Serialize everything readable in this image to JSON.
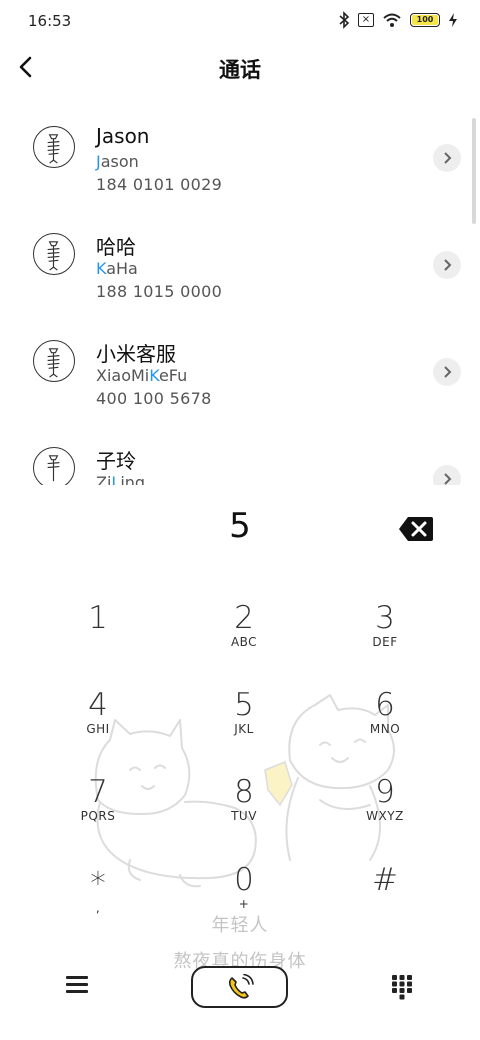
{
  "status_bar": {
    "time": "16:53",
    "battery": "100"
  },
  "header": {
    "title": "通话"
  },
  "contacts": [
    {
      "name": "Jason",
      "pinyin_hl": "J",
      "pinyin_rest": "ason",
      "phone": "184 0101 0029"
    },
    {
      "name": "哈哈",
      "pinyin_hl": "K",
      "pinyin_rest": "aHa",
      "phone": "188 1015 0000"
    },
    {
      "name": "小米客服",
      "pinyin_pre": "XiaoMi",
      "pinyin_hl": "K",
      "pinyin_rest": "eFu",
      "phone": "400 100 5678"
    },
    {
      "name": "子玲",
      "pinyin_pre": "Zi",
      "pinyin_hl": "L",
      "pinyin_rest": "ing",
      "phone": ""
    }
  ],
  "dialer": {
    "input": "5",
    "keys": [
      {
        "digit": "1",
        "letters": ""
      },
      {
        "digit": "2",
        "letters": "ABC"
      },
      {
        "digit": "3",
        "letters": "DEF"
      },
      {
        "digit": "4",
        "letters": "GHI"
      },
      {
        "digit": "5",
        "letters": "JKL"
      },
      {
        "digit": "6",
        "letters": "MNO"
      },
      {
        "digit": "7",
        "letters": "PQRS"
      },
      {
        "digit": "8",
        "letters": "TUV"
      },
      {
        "digit": "9",
        "letters": "WXYZ"
      },
      {
        "digit": "*",
        "letters": ","
      },
      {
        "digit": "0",
        "letters": "+"
      },
      {
        "digit": "#",
        "letters": ""
      }
    ]
  },
  "theme": {
    "tagline_line1": "年轻人",
    "tagline_line2": "熬夜真的伤身体",
    "accent": "#2896e8",
    "call_icon_color": "#f5c518"
  },
  "icons": {
    "back": "back-arrow-icon",
    "detail": "chevron-right-icon",
    "delete": "backspace-icon",
    "menu": "menu-icon",
    "call": "phone-call-icon",
    "keypad": "dialpad-icon"
  }
}
